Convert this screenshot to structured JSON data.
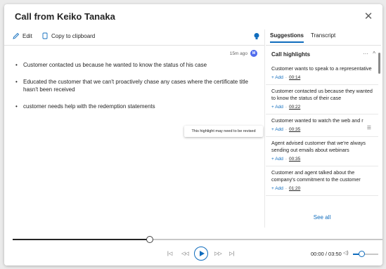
{
  "dialog": {
    "title": "Call from Keiko Tanaka",
    "close_glyph": "✕"
  },
  "toolbar": {
    "edit_label": "Edit",
    "copy_label": "Copy to clipboard"
  },
  "notes": {
    "time_ago": "15m ago",
    "avatar_initial": "M",
    "items": [
      "Customer contacted us because he wanted to know the status of his case",
      "Educated the customer that we can't proactively chase any cases where the certificate title hasn't been received",
      "customer needs help with the redemption statements"
    ],
    "tooltip": "This highlight may need to be revised",
    "collapse_glyph": "^"
  },
  "tabs": [
    {
      "label": "Suggestions",
      "active": true
    },
    {
      "label": "Transcript",
      "active": false
    }
  ],
  "highlights": {
    "header": "Call highlights",
    "more_glyph": "···",
    "chevron_glyph": "^",
    "add_label": "+ Add",
    "separator": "·",
    "cards": [
      {
        "text": "Customer wants to speak to a representative",
        "time": "00:14"
      },
      {
        "text": "Customer contacted us because they wanted to know the status of their case",
        "time": "00:22"
      },
      {
        "text": "Customer wanted to watch the web and r",
        "time": "00:35"
      },
      {
        "text": "Agent advised customer that we're always sending out emails about webinars",
        "time": "00:35"
      },
      {
        "text": "Customer and agent talked about the company's commitment to the customer",
        "time": "01:20"
      }
    ],
    "see_all": "See all"
  },
  "player": {
    "progress": 0.37,
    "volume": 0.35,
    "time_display": "00:00 / 03:50",
    "icons": {
      "prev": "|◁",
      "rewind": "◁◁",
      "forward": "▷▷",
      "next": "▷|",
      "volume": "◁)"
    }
  },
  "colors": {
    "accent": "#0f6cbd",
    "avatar": "#4f6bed"
  }
}
